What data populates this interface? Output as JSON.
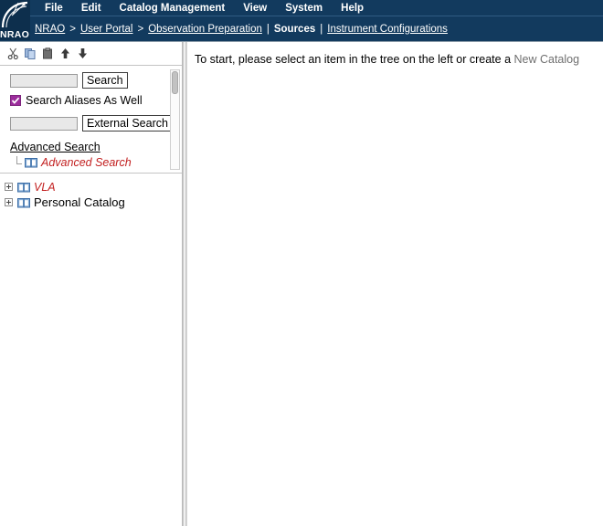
{
  "app": {
    "logo_alt": "NRAO",
    "header_bg": "#123a5e",
    "accent_red": "#c21f1f",
    "checkbox_color": "#9c2d9c"
  },
  "menubar": {
    "items": [
      {
        "label": "File",
        "name": "menu-file"
      },
      {
        "label": "Edit",
        "name": "menu-edit"
      },
      {
        "label": "Catalog Management",
        "name": "menu-catalog-management"
      },
      {
        "label": "View",
        "name": "menu-view"
      },
      {
        "label": "System",
        "name": "menu-system"
      },
      {
        "label": "Help",
        "name": "menu-help"
      }
    ]
  },
  "breadcrumb": {
    "items": [
      {
        "label": "NRAO",
        "type": "link"
      },
      {
        "label": ">",
        "type": "sep"
      },
      {
        "label": "User Portal",
        "type": "link"
      },
      {
        "label": ">",
        "type": "sep"
      },
      {
        "label": "Observation Preparation",
        "type": "link"
      },
      {
        "label": "|",
        "type": "sep"
      },
      {
        "label": "Sources",
        "type": "current"
      },
      {
        "label": "|",
        "type": "sep"
      },
      {
        "label": "Instrument Configurations",
        "type": "link"
      }
    ]
  },
  "toolbar": {
    "buttons": [
      {
        "icon": "cut-icon",
        "title": "Cut"
      },
      {
        "icon": "copy-icon",
        "title": "Copy"
      },
      {
        "icon": "paste-icon",
        "title": "Paste"
      },
      {
        "icon": "move-up-icon",
        "title": "Move Up"
      },
      {
        "icon": "move-down-icon",
        "title": "Move Down"
      }
    ]
  },
  "search_panel": {
    "search_input_value": "",
    "search_input_placeholder": "",
    "search_button_label": "Search",
    "aliases_checkbox_checked": true,
    "aliases_label": "Search Aliases As Well",
    "external_input_value": "",
    "external_input_placeholder": "",
    "external_button_label": "External Search",
    "advanced_search_header": "Advanced Search",
    "advanced_search_node": "Advanced Search"
  },
  "catalog_tree": {
    "items": [
      {
        "label": "VLA",
        "style": "red-italic",
        "expanded": false
      },
      {
        "label": "Personal Catalog",
        "style": "normal",
        "expanded": false
      }
    ]
  },
  "main": {
    "message_prefix": "To start, please select an item in the tree on the left or create a ",
    "new_catalog_link": "New Catalog"
  }
}
